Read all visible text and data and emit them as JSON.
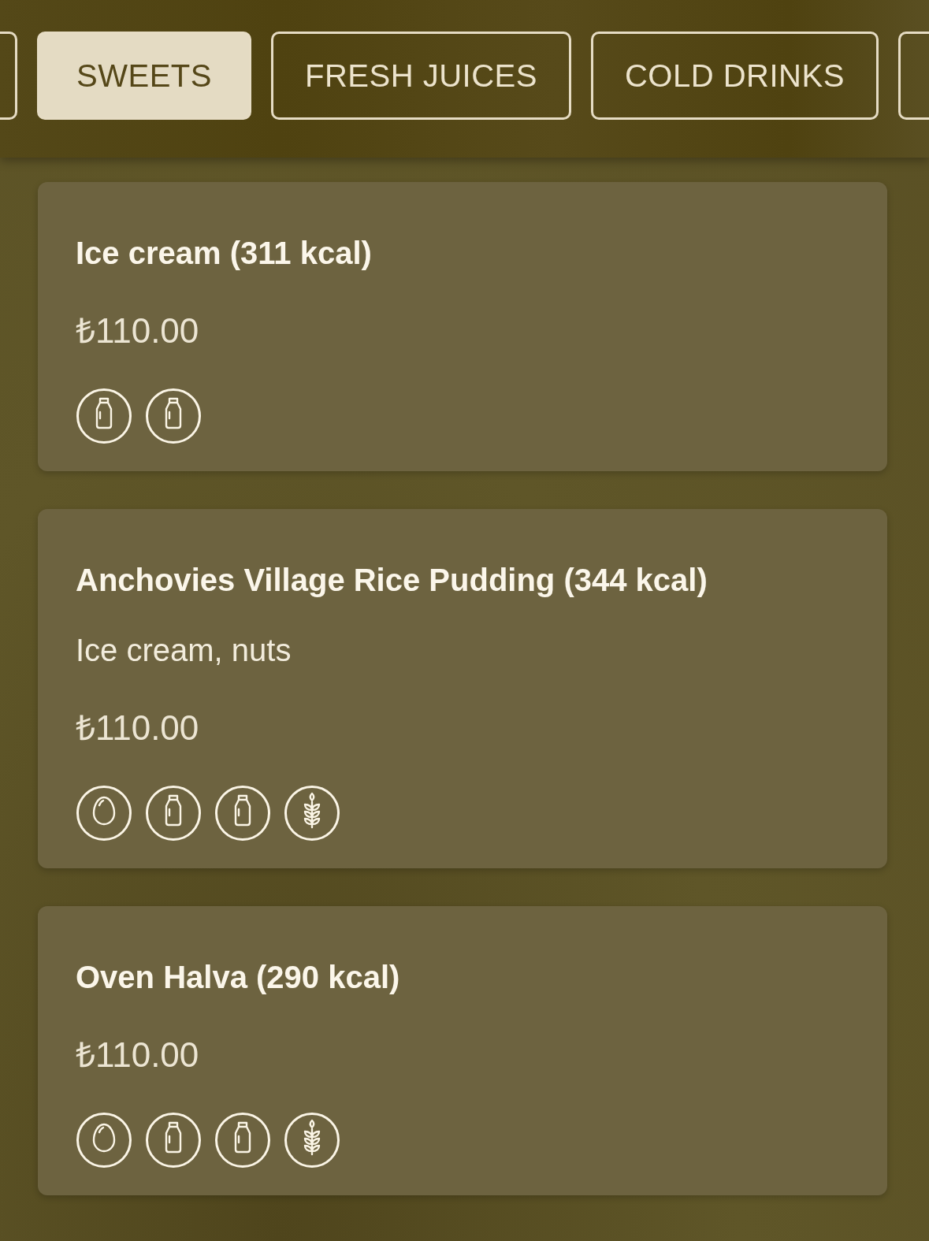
{
  "tabs": [
    {
      "selected": false
    },
    {
      "label": "SWEETS",
      "selected": true
    },
    {
      "label": "FRESH JUICES",
      "selected": false
    },
    {
      "label": "COLD DRINKS",
      "selected": false
    },
    {
      "selected": false
    }
  ],
  "items": [
    {
      "name": "Ice cream (311 kcal)",
      "price": "₺110.00",
      "allergens": [
        {
          "kind": "milk"
        },
        {
          "kind": "milk"
        }
      ]
    },
    {
      "name": "Anchovies Village Rice Pudding (344 kcal)",
      "description": "Ice cream, nuts",
      "price": "₺110.00",
      "allergens": [
        {
          "kind": "egg"
        },
        {
          "kind": "milk"
        },
        {
          "kind": "milk"
        },
        {
          "kind": "gluten"
        }
      ]
    },
    {
      "name": "Oven Halva (290 kcal)",
      "price": "₺110.00",
      "allergens": [
        {
          "kind": "egg"
        },
        {
          "kind": "milk"
        },
        {
          "kind": "milk"
        },
        {
          "kind": "gluten"
        }
      ]
    }
  ]
}
